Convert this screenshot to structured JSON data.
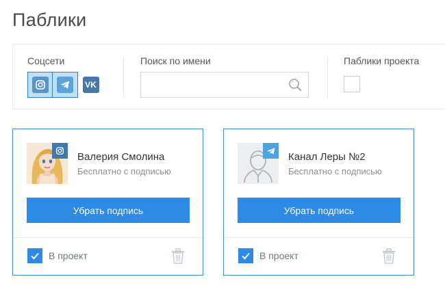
{
  "page": {
    "title": "Паблики"
  },
  "filters": {
    "social_label": "Соцсети",
    "social_buttons": [
      {
        "icon": "instagram-icon",
        "active": true
      },
      {
        "icon": "telegram-icon",
        "active": true
      },
      {
        "icon": "vk-icon",
        "active": false,
        "text": "VK"
      }
    ],
    "search_label": "Поиск по имени",
    "search_value": "",
    "search_placeholder": "",
    "project_label": "Паблики проекта",
    "project_checked": false
  },
  "cards": [
    {
      "name": "Валерия Смолина",
      "subtitle": "Бесплатно с подписью",
      "network": "instagram",
      "avatar": "photo",
      "button_label": "Убрать подпись",
      "project_label": "В проект",
      "project_checked": true
    },
    {
      "name": "Канал Леры №2",
      "subtitle": "Бесплатно с подписью",
      "network": "telegram",
      "avatar": "default-user",
      "button_label": "Убрать подпись",
      "project_label": "В проект",
      "project_checked": true
    }
  ],
  "colors": {
    "accent": "#2d8ae5",
    "card_border": "#3d8bd9",
    "social_active_bg": "#bfe0f5"
  }
}
